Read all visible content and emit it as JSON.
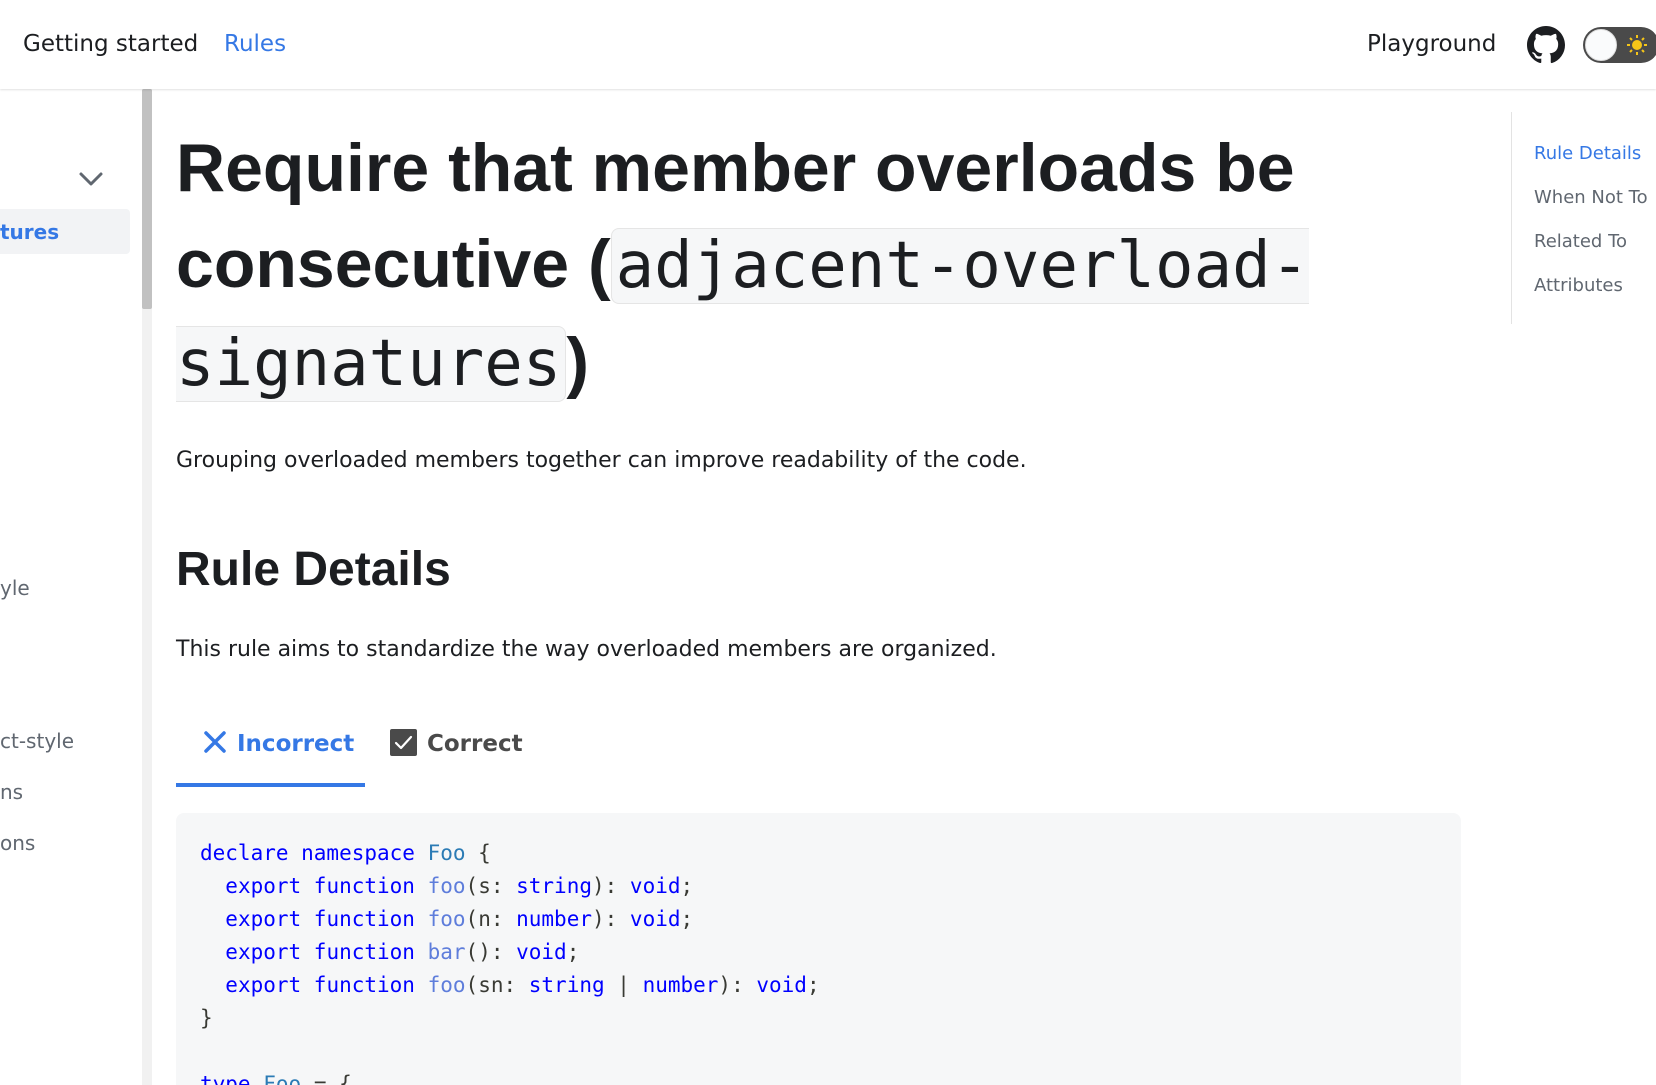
{
  "navbar": {
    "getting_started": "Getting started",
    "rules": "Rules",
    "playground": "Playground",
    "github_icon": "github-icon",
    "theme_toggle": "dark-mode-toggle"
  },
  "sidebar": {
    "items": [
      {
        "label": "tures",
        "active": true
      },
      {
        "label": "yle"
      },
      {
        "label": "ct-style"
      },
      {
        "label": "ns"
      },
      {
        "label": "ons"
      }
    ]
  },
  "main": {
    "title_text": "Require that member overloads be consecutive (",
    "title_code": "adjacent-overload-signatures",
    "title_close": ")",
    "intro": "Grouping overloaded members together can improve readability of the code.",
    "section_heading": "Rule Details",
    "section_text": "This rule aims to standardize the way overloaded members are organized.",
    "tabs": [
      {
        "label": "Incorrect",
        "icon": "x-icon",
        "active": true
      },
      {
        "label": "Correct",
        "icon": "check-icon",
        "active": false
      }
    ],
    "code_lines": [
      "declare namespace Foo {",
      "  export function foo(s: string): void;",
      "  export function foo(n: number): void;",
      "  export function bar(): void;",
      "  export function foo(sn: string | number): void;",
      "}",
      "",
      "type Foo = {"
    ]
  },
  "toc": {
    "items": [
      {
        "label": "Rule Details",
        "active": true
      },
      {
        "label": "When Not To"
      },
      {
        "label": "Related To"
      },
      {
        "label": "Attributes"
      }
    ]
  },
  "colors": {
    "accent": "#3578e5",
    "text": "#1c1e21",
    "code_bg": "#f6f7f8"
  }
}
